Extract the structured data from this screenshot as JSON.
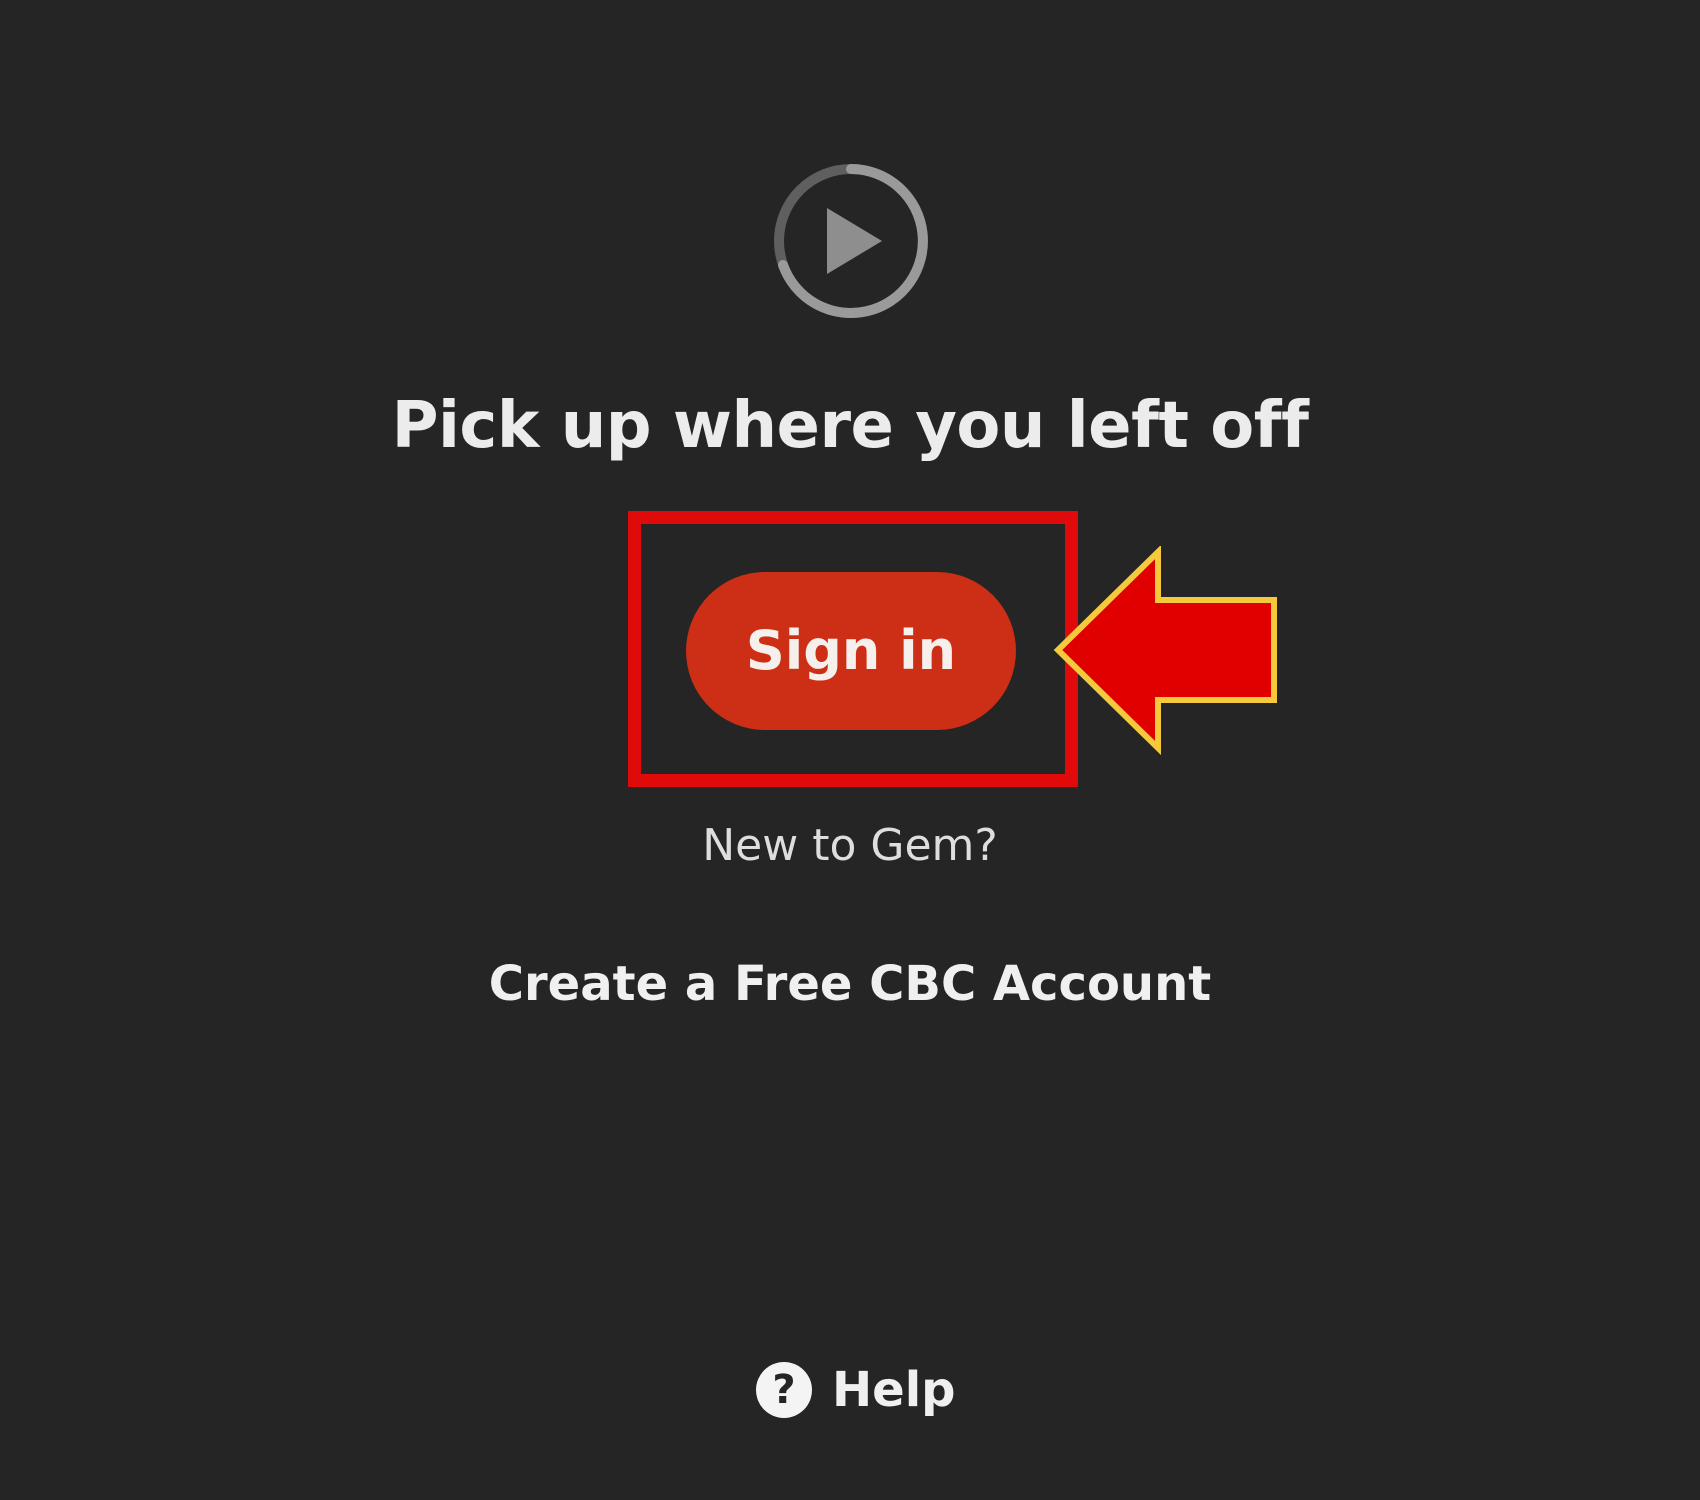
{
  "headline": "Pick up where you left off",
  "sign_in": {
    "label": "Sign in"
  },
  "new_to_gem": "New to Gem?",
  "create_account": "Create a Free CBC Account",
  "help": {
    "icon_glyph": "?",
    "label": "Help"
  },
  "icons": {
    "logo": "play-circle-icon",
    "callout": "left-arrow-icon",
    "help": "question-circle-icon"
  },
  "colors": {
    "background": "#252525",
    "sign_in_button": "#cd2f16",
    "highlight_box": "#e00a0a",
    "callout_arrow_fill": "#e00000",
    "callout_arrow_outline": "#f5c93c",
    "logo": "#8a8a8a"
  }
}
